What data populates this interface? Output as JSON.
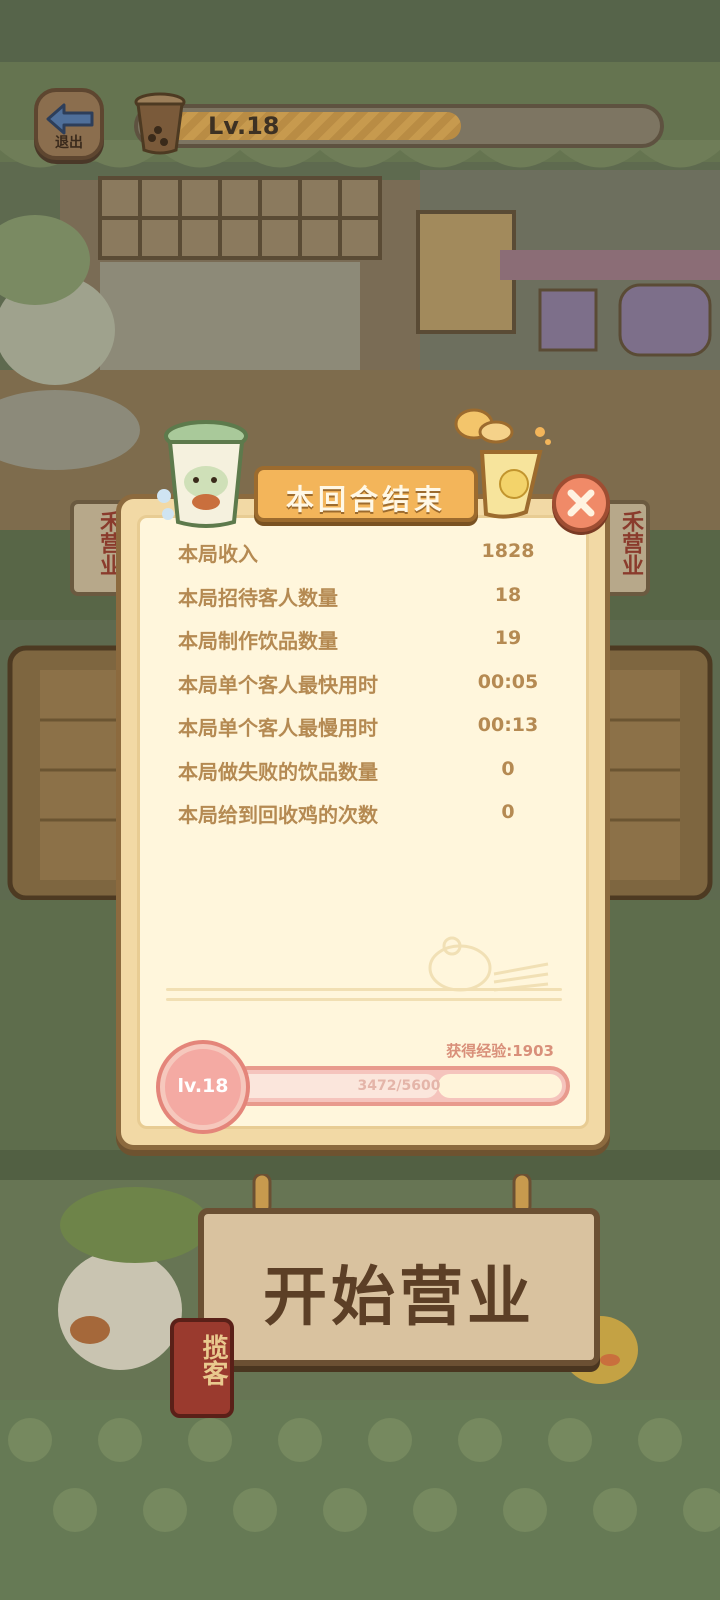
{
  "hud": {
    "exit_label": "退出",
    "level_text": "Lv.18",
    "level_progress": 0.62
  },
  "dialog": {
    "title": "本回合结束",
    "stats": [
      {
        "label": "本局收入",
        "value": "1828"
      },
      {
        "label": "本局招待客人数量",
        "value": "18"
      },
      {
        "label": "本局制作饮品数量",
        "value": "19"
      },
      {
        "label": "本局单个客人最快用时",
        "value": "00:05"
      },
      {
        "label": "本局单个客人最慢用时",
        "value": "00:13"
      },
      {
        "label": "本局做失败的饮品数量",
        "value": "0"
      },
      {
        "label": "本局给到回收鸡的次数",
        "value": "0"
      }
    ],
    "exp_gained_label": "获得经验:1903",
    "exp_badge": "lv.18",
    "exp_progress_text": "3472/5600",
    "exp_progress": 0.62
  },
  "bottom": {
    "open_sign": "开始营业",
    "solicit_tag": "揽客"
  },
  "side_shops": {
    "left": "禾营业",
    "right": "禾营业"
  },
  "colors": {
    "accent": "#f3b55a",
    "panel": "#fff6dc",
    "stat_text": "#b58a52",
    "exp_pink": "#e89a8d"
  }
}
